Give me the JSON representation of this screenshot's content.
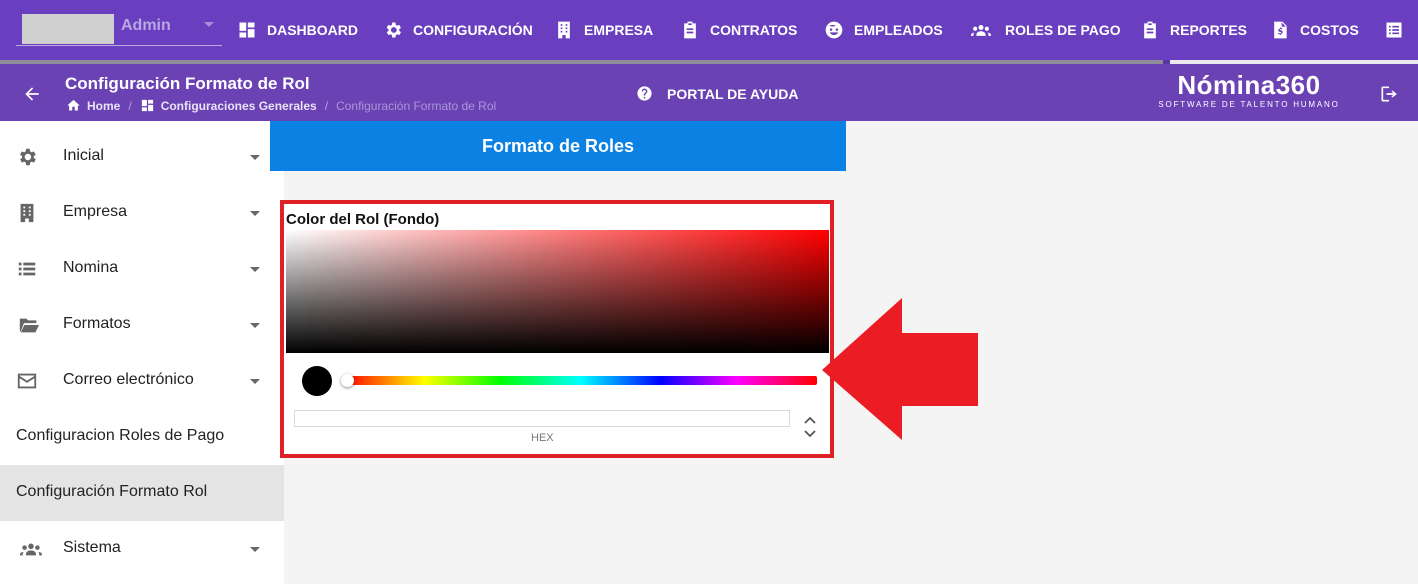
{
  "topnav": {
    "user_name": "Admin",
    "progress_percent": 82,
    "items": [
      {
        "label": "DASHBOARD",
        "icon": "dashboard-icon"
      },
      {
        "label": "CONFIGURACIÓN",
        "icon": "gear-icon"
      },
      {
        "label": "EMPRESA",
        "icon": "building-icon"
      },
      {
        "label": "CONTRATOS",
        "icon": "clipboard-icon"
      },
      {
        "label": "EMPLEADOS",
        "icon": "face-icon"
      },
      {
        "label": "ROLES DE PAGO",
        "icon": "people-icon"
      },
      {
        "label": "REPORTES",
        "icon": "clipboard-check-icon"
      },
      {
        "label": "COSTOS",
        "icon": "file-dollar-icon"
      }
    ]
  },
  "header": {
    "title": "Configuración Formato de Rol",
    "breadcrumb": [
      "Home",
      "Configuraciones Generales",
      "Configuración Formato de Rol"
    ],
    "help_label": "PORTAL DE AYUDA",
    "brand_name": "Nómina360",
    "brand_tagline": "SOFTWARE DE TALENTO HUMANO"
  },
  "sidebar": {
    "items": [
      {
        "label": "Inicial",
        "icon": "gear-icon"
      },
      {
        "label": "Empresa",
        "icon": "building-icon"
      },
      {
        "label": "Nomina",
        "icon": "list-icon"
      },
      {
        "label": "Formatos",
        "icon": "folder-open-icon"
      },
      {
        "label": "Correo electrónico",
        "icon": "mail-icon"
      },
      {
        "label": "Configuracion Roles de Pago"
      },
      {
        "label": "Configuración Formato Rol",
        "active": true
      },
      {
        "label": "Sistema",
        "icon": "people-icon"
      }
    ]
  },
  "main": {
    "card_title": "Formato de Roles",
    "picker": {
      "label": "Color del Rol (Fondo)",
      "hex_value": "",
      "hex_label": "HEX",
      "swatch_color": "#000000",
      "hue_color": "#ff0000"
    }
  },
  "colors": {
    "nav_bg": "#6a3fbf",
    "subheader_bg": "#6b42b4",
    "card_header_bg": "#0b81e4",
    "highlight_red": "#e02027"
  }
}
